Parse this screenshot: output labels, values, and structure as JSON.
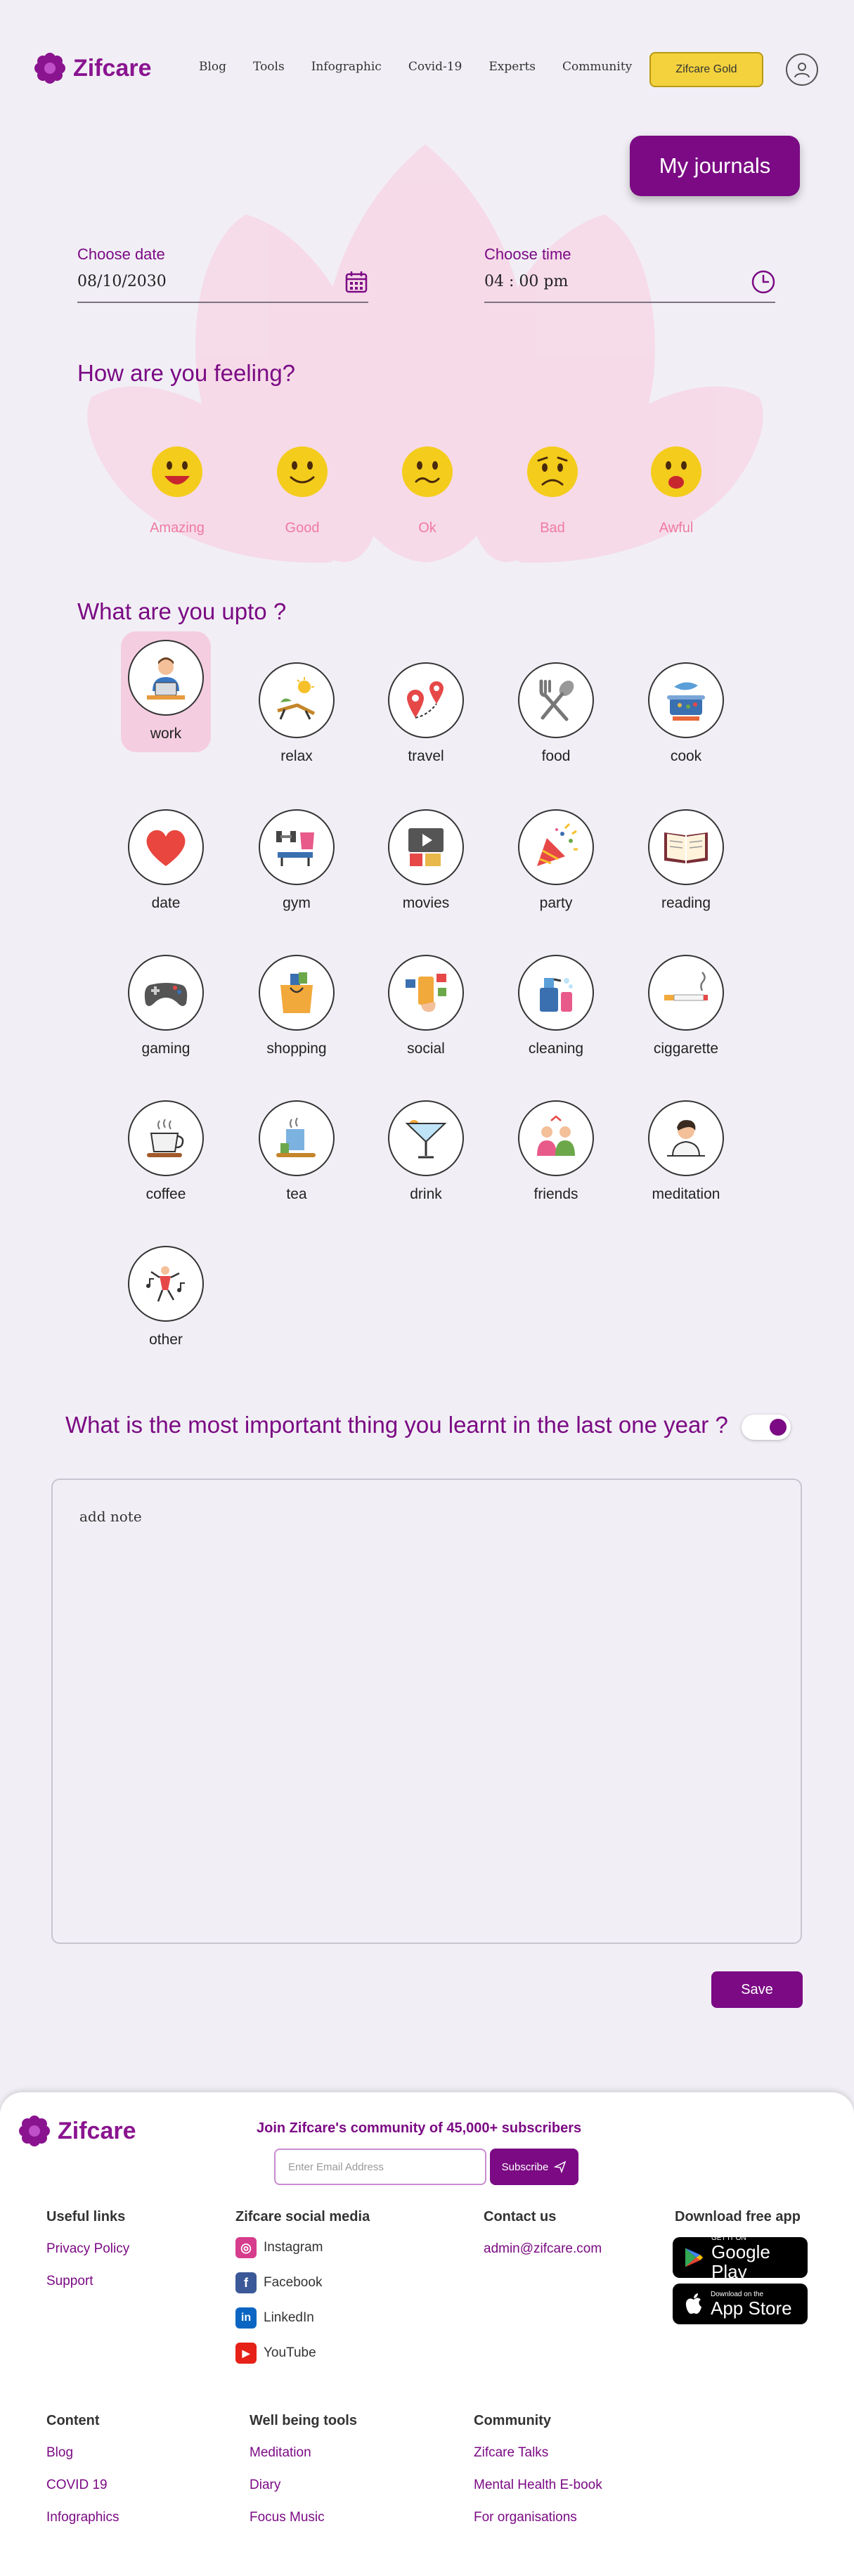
{
  "header": {
    "brand": "Zifcare",
    "nav": [
      "Blog",
      "Tools",
      "Infographic",
      "Covid-19",
      "Experts",
      "Community"
    ],
    "gold_button": "Zifcare Gold",
    "journals_button": "My journals"
  },
  "entry": {
    "date_label": "Choose date",
    "date_value": "08/10/2030",
    "time_label": "Choose time",
    "time_value": "04 : 00 pm"
  },
  "feeling": {
    "title": "How are you feeling?",
    "moods": [
      "Amazing",
      "Good",
      "Ok",
      "Bad",
      "Awful"
    ]
  },
  "activities": {
    "title": "What are you upto ?",
    "selected": "work",
    "items": [
      "work",
      "relax",
      "travel",
      "food",
      "cook",
      "date",
      "gym",
      "movies",
      "party",
      "reading",
      "gaming",
      "shopping",
      "social",
      "cleaning",
      "ciggarette",
      "coffee",
      "tea",
      "drink",
      "friends",
      "meditation",
      "other"
    ]
  },
  "question": {
    "text": "What is the most important thing you learnt in the last one year ?",
    "toggle_on": true
  },
  "note": {
    "placeholder": "add note",
    "save_label": "Save"
  },
  "footer": {
    "brand": "Zifcare",
    "join_text": "Join Zifcare's community of 45,000+ subscribers",
    "email_placeholder": "Enter Email Address",
    "subscribe_label": "Subscribe",
    "useful_links": {
      "title": "Useful links",
      "items": [
        "Privacy Policy",
        "Support"
      ]
    },
    "social": {
      "title": "Zifcare social media",
      "items": [
        "Instagram",
        "Facebook",
        "LinkedIn",
        "YouTube"
      ]
    },
    "contact": {
      "title": "Contact us",
      "email": "admin@zifcare.com"
    },
    "download": {
      "title": "Download free app",
      "google_small": "GET IT ON",
      "google_big": "Google Play",
      "apple_small": "Download on the",
      "apple_big": "App Store"
    },
    "content": {
      "title": "Content",
      "items": [
        "Blog",
        "COVID 19",
        "Infographics"
      ]
    },
    "wellbeing": {
      "title": "Well being tools",
      "items": [
        "Meditation",
        "Diary",
        "Focus Music"
      ]
    },
    "community": {
      "title": "Community",
      "items": [
        "Zifcare Talks",
        "Mental Health E-book",
        "For organisations"
      ]
    }
  },
  "colors": {
    "brand": "#7b0a84",
    "gold": "#f3d23d",
    "mood_label": "#f07aa0",
    "background": "#f1eff5"
  }
}
